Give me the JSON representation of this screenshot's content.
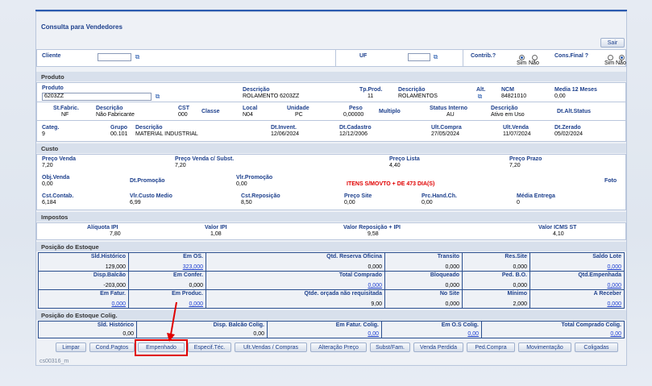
{
  "title": "Consulta para Vendedores",
  "sair": "Sair",
  "cliente": {
    "label": "Cliente",
    "value": ""
  },
  "uf": {
    "label": "UF",
    "value": ""
  },
  "contrib": {
    "label": "Contrib.?",
    "sim": "Sim",
    "nao": "Não",
    "selected": "Sim"
  },
  "consfinal": {
    "label": "Cons.Final ?",
    "sim": "Sim",
    "nao": "Não",
    "selected": "Não"
  },
  "produto_section": "Produto",
  "produto": {
    "produto_label": "Produto",
    "produto_value": "6203ZZ",
    "descricao_label": "Descrição",
    "descricao_value": "ROLAMENTO 6203ZZ",
    "tpprod_label": "Tp.Prod.",
    "tpprod_value": "11",
    "descricao2_label": "Descrição",
    "descricao2_value": "ROLAMENTOS",
    "alt_label": "Alt.",
    "ncm_label": "NCM",
    "ncm_value": "84821010",
    "media_label": "Media 12 Meses",
    "media_value": "0,00",
    "stfabric_label": "St.Fabric.",
    "stfabric_value": "NF",
    "desc3_label": "Descrição",
    "desc3_value": "Não Fabricante",
    "cst_label": "CST",
    "cst_value": "000",
    "classe_label": "Classe",
    "local_label": "Local",
    "local_value": "N04",
    "unidade_label": "Unidade",
    "unidade_value": "PC",
    "peso_label": "Peso",
    "peso_value": "0,00000",
    "multiplo_label": "Multiplo",
    "status_label": "Status Interno",
    "status_value": "AU",
    "desc4_label": "Descrição",
    "desc4_value": "Ativo em Uso",
    "dtalt_label": "Dt.Alt.Status",
    "categ_label": "Categ.",
    "categ_value": "9",
    "grupo_label": "Grupo",
    "grupo_value": "00.101",
    "desc5_label": "Descrição",
    "desc5_value": "MATERIAL INDUSTRIAL",
    "dtinvent_label": "Dt.Invent.",
    "dtinvent_value": "12/06/2024",
    "dtcad_label": "Dt.Cadastro",
    "dtcad_value": "12/12/2006",
    "ultcompra_label": "Ult.Compra",
    "ultcompra_value": "27/05/2024",
    "ultvenda_label": "Ult.Venda",
    "ultvenda_value": "11/07/2024",
    "dtzerado_label": "Dt.Zerado",
    "dtzerado_value": "05/02/2024"
  },
  "custo_section": "Custo",
  "custo": {
    "pv_label": "Preço Venda",
    "pv_value": "7,20",
    "pvsubst_label": "Preço Venda c/ Subst.",
    "pvsubst_value": "7,20",
    "plista_label": "Preço Lista",
    "plista_value": "4,40",
    "pprazo_label": "Preço Prazo",
    "pprazo_value": "7,20",
    "objvenda_label": "Obj.Venda",
    "objvenda_value": "0,00",
    "dtpromo_label": "Dt.Promoção",
    "vlrpromo_label": "Vlr.Promoção",
    "vlrpromo_value": "0,00",
    "alerta": "ITENS S/MOVTO + DE 473 DIA(S)",
    "foto_label": "Foto",
    "cstcontab_label": "Cst.Contab.",
    "cstcontab_value": "6,184",
    "vlrcusto_label": "Vlr.Custo Medio",
    "vlrcusto_value": "6,99",
    "cstrep_label": "Cst.Reposição",
    "cstrep_value": "8,50",
    "psite_label": "Preço Site",
    "psite_value": "0,00",
    "prchand_label": "Prc.Hand.Ch.",
    "prchand_value": "0,00",
    "mediaentrega_label": "Média Entrega",
    "mediaentrega_value": "0"
  },
  "impostos_section": "Impostos",
  "impostos": {
    "aliq_label": "Alíquota IPI",
    "aliq_value": "7,80",
    "vipi_label": "Valor IPI",
    "vipi_value": "1,08",
    "vrep_label": "Valor Reposição + IPI",
    "vrep_value": "9,58",
    "vicms_label": "Valor ICMS ST",
    "vicms_value": "4,10"
  },
  "estoque_section": "Posição do Estoque",
  "estoque": {
    "r1": [
      {
        "l": "Sld.Histórico",
        "v": "129,000"
      },
      {
        "l": "Em OS.",
        "v": "323,000",
        "link": true
      },
      {
        "l": "Qtd. Reserva Oficina",
        "v": "0,000"
      },
      {
        "l": "Transito",
        "v": "0,000"
      },
      {
        "l": "Res.Site",
        "v": "0,000"
      },
      {
        "l": "Saldo Lote",
        "v": "0,000",
        "link": true
      }
    ],
    "r2": [
      {
        "l": "Disp.Balcão",
        "v": "-203,000"
      },
      {
        "l": "Em Confer.",
        "v": "0,000"
      },
      {
        "l": "Total Comprado",
        "v": "0,000",
        "link": true
      },
      {
        "l": "Bloqueado",
        "v": "0,000"
      },
      {
        "l": "Ped. B.O.",
        "v": "0,000"
      },
      {
        "l": "Qtd.Empenhada",
        "v": "0,000",
        "link": true
      }
    ],
    "r3": [
      {
        "l": "Em Fatur.",
        "v": "0,000",
        "link": true
      },
      {
        "l": "Em Produc.",
        "v": "0,000",
        "link": true
      },
      {
        "l": "Qtde. orçada não requisitada",
        "v": "9,00"
      },
      {
        "l": "No Site",
        "v": "0,000"
      },
      {
        "l": "Mínimo",
        "v": "2,000"
      },
      {
        "l": "A Receber",
        "v": "0,000",
        "link": true
      }
    ]
  },
  "coligadas_section": "Posição do Estoque Colig.",
  "coligadas": [
    {
      "l": "Sld. Histórico",
      "v": "0,00"
    },
    {
      "l": "Disp. Balcão Colig.",
      "v": "0,00"
    },
    {
      "l": "Em Fatur. Colig.",
      "v": "0,00",
      "link": true
    },
    {
      "l": "Em O.S Colig.",
      "v": "0,00",
      "link": true
    },
    {
      "l": "Total Comprado Colig.",
      "v": "0,00",
      "link": true
    }
  ],
  "buttons": [
    "Limpar",
    "Cond.Pagtos",
    "Empenhado",
    "Especif.Téc.",
    "Ult.Vendas / Compras",
    "Alteração Preço",
    "Subst/Fam.",
    "Venda Perdida",
    "Ped.Compra",
    "Movimentação",
    "Coligadas"
  ],
  "footer": "cs00316_m",
  "colors": {
    "accent": "#1c3f8c",
    "highlight": "#e00000",
    "link": "#1d3fd0"
  }
}
